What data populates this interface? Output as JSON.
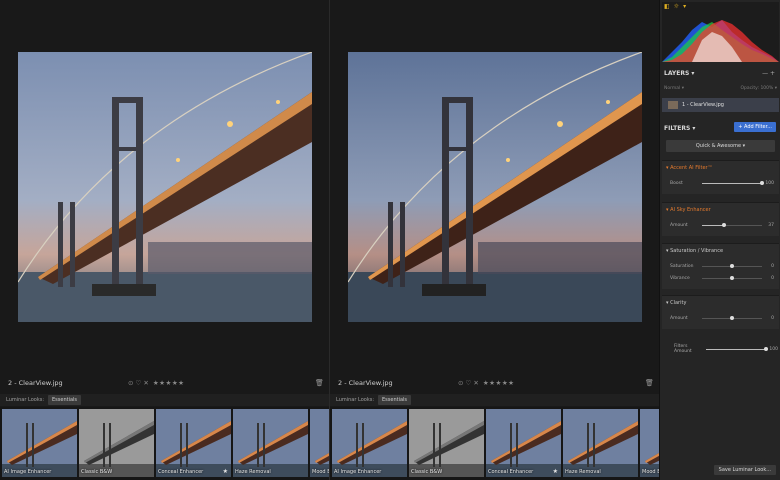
{
  "left_pane": {
    "filename": "2 - ClearView.jpg",
    "looks_label": "Luminar Looks:",
    "looks_tab": "Essentials",
    "thumbs": [
      {
        "label": "AI Image Enhancer",
        "bw": false,
        "star": false
      },
      {
        "label": "Classic B&W",
        "bw": true,
        "star": false
      },
      {
        "label": "Conceal Enhancer",
        "bw": false,
        "star": true
      },
      {
        "label": "Haze Removal",
        "bw": false,
        "star": false
      },
      {
        "label": "Mood Enh",
        "bw": false,
        "star": false
      }
    ]
  },
  "right_pane": {
    "filename": "2 - ClearView.jpg",
    "looks_label": "Luminar Looks:",
    "looks_tab": "Essentials",
    "thumbs": [
      {
        "label": "AI Image Enhancer",
        "bw": false,
        "star": false
      },
      {
        "label": "Classic B&W",
        "bw": true,
        "star": false
      },
      {
        "label": "Conceal Enhancer",
        "bw": false,
        "star": true
      },
      {
        "label": "Haze Removal",
        "bw": false,
        "star": false
      },
      {
        "label": "Mood Enh",
        "bw": false,
        "star": false
      }
    ]
  },
  "info": {
    "rating_icons": "⊙ ♡ ✕",
    "stars": "★★★★★",
    "trash": "🗑"
  },
  "panel": {
    "layers_title": "LAYERS ▾",
    "layers_blend": "Normal ▾",
    "layers_opacity": "Opacity: 100% ▾",
    "layer_name": "1 - ClearView.jpg",
    "filters_title": "FILTERS ▾",
    "add_filter": "+ Add Filter...",
    "quick_btn": "Quick & Awesome ▾",
    "filters": [
      {
        "title": "Accent AI Filter™",
        "highlight": true,
        "sliders": [
          {
            "label": "Boost",
            "value": 100
          }
        ]
      },
      {
        "title": "AI Sky Enhancer",
        "highlight": true,
        "sliders": [
          {
            "label": "Amount",
            "value": 37
          }
        ]
      },
      {
        "title": "Saturation / Vibrance",
        "highlight": false,
        "sliders": [
          {
            "label": "Saturation",
            "value": 0
          },
          {
            "label": "Vibrance",
            "value": 0
          }
        ]
      },
      {
        "title": "Clarity",
        "highlight": false,
        "sliders": [
          {
            "label": "Amount",
            "value": 0
          }
        ]
      }
    ],
    "filters_amount": {
      "label": "Filters Amount",
      "value": 100
    },
    "save_button": "Save Luminar Look..."
  },
  "colors": {
    "accent": "#3a6fd1",
    "highlight": "#e47a2e",
    "background": "#191919"
  }
}
